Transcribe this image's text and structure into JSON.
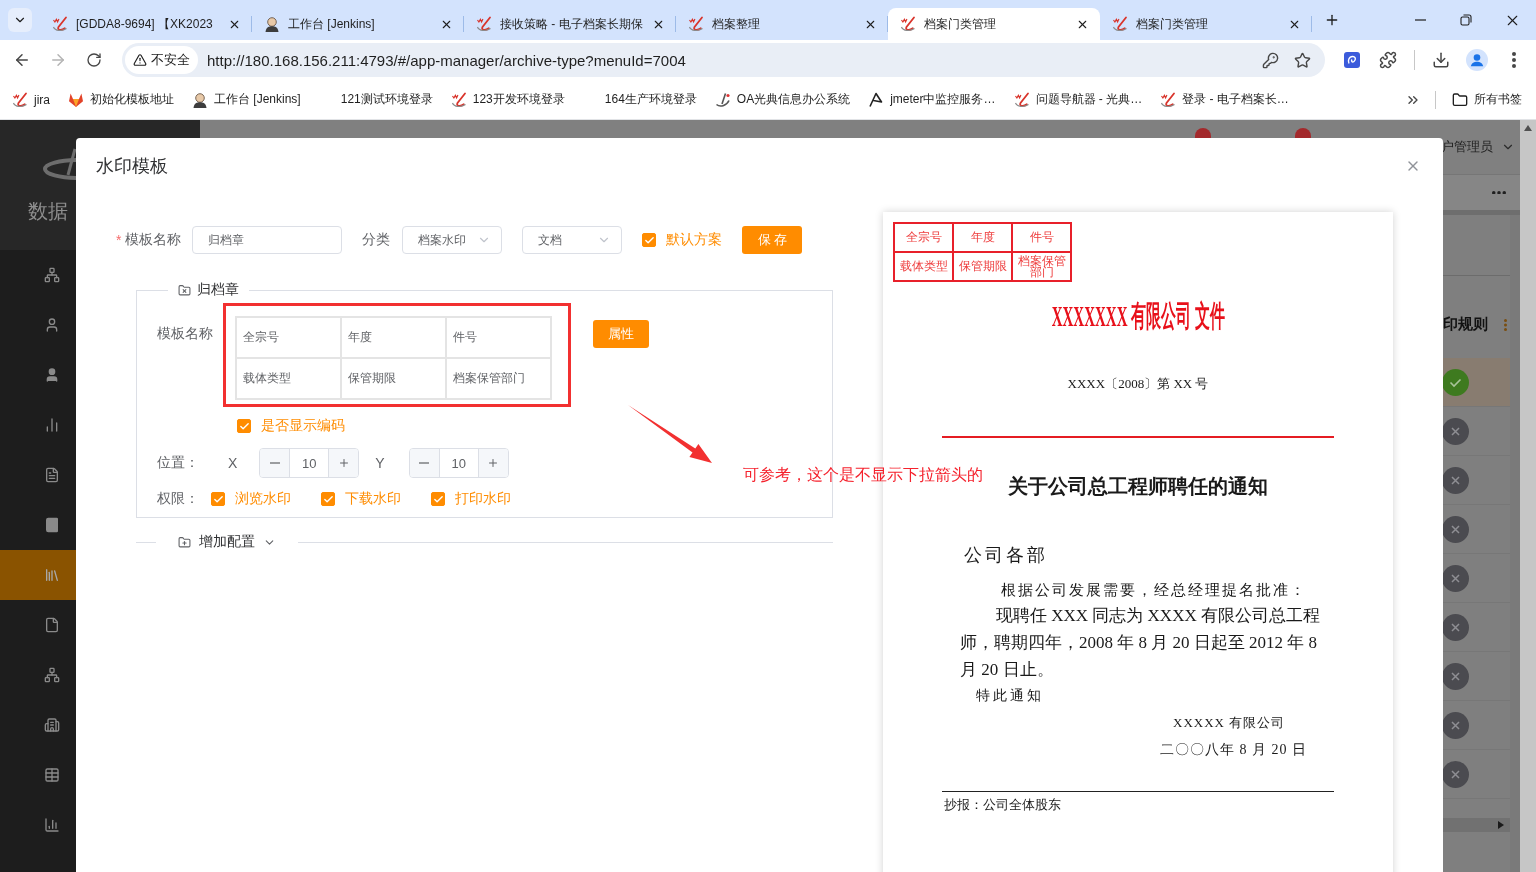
{
  "browser": {
    "tabs": [
      {
        "kind": "swirl",
        "title": "[GDDA8-9694] 【XK2023",
        "selected": false
      },
      {
        "kind": "avatar",
        "title": "工作台 [Jenkins]",
        "selected": false
      },
      {
        "kind": "swirl",
        "title": "接收策略 - 电子档案长期保",
        "selected": false
      },
      {
        "kind": "swirl",
        "title": "档案整理",
        "selected": false
      },
      {
        "kind": "swirl",
        "title": "档案门类管理",
        "selected": true
      },
      {
        "kind": "swirl",
        "title": "档案门类管理",
        "selected": false
      }
    ],
    "address_bar": {
      "security": "不安全",
      "url": "http://180.168.156.211:4793/#/app-manager/archive-type?menuId=7004"
    },
    "bookmarks": [
      {
        "kind": "swirl",
        "label": "jira"
      },
      {
        "kind": "fox",
        "label": "初始化模板地址"
      },
      {
        "kind": "avatar",
        "label": "工作台 [Jenkins]"
      },
      {
        "kind": "blank",
        "label": "121测试环境登录"
      },
      {
        "kind": "swirl",
        "label": "123开发环境登录"
      },
      {
        "kind": "blank",
        "label": "164生产环境登录"
      },
      {
        "kind": "ladle",
        "label": "OA光典信息办公系统"
      },
      {
        "kind": "feather",
        "label": "jmeter中监控服务…"
      },
      {
        "kind": "swirl",
        "label": "问题导航器 - 光典…"
      },
      {
        "kind": "swirl",
        "label": "登录 - 电子档案长…"
      }
    ],
    "all_bookmarks": "所有书签"
  },
  "app": {
    "sidebar": {
      "brand": "数据",
      "items": [
        {
          "selected": false
        },
        {
          "selected": false
        },
        {
          "selected": false
        },
        {
          "selected": false
        },
        {
          "selected": false
        },
        {
          "selected": false
        },
        {
          "selected": true
        },
        {
          "selected": false
        },
        {
          "selected": false
        },
        {
          "selected": false
        },
        {
          "selected": false
        },
        {
          "selected": false
        }
      ]
    },
    "header": {
      "user": "户管理员"
    },
    "rules": {
      "title": "印规则",
      "rows": [
        {
          "enabled": true,
          "selected": true
        },
        {
          "enabled": false,
          "selected": false
        },
        {
          "enabled": false,
          "selected": false
        },
        {
          "enabled": false,
          "selected": false
        },
        {
          "enabled": false,
          "selected": false
        },
        {
          "enabled": false,
          "selected": false
        },
        {
          "enabled": false,
          "selected": false
        },
        {
          "enabled": false,
          "selected": false
        },
        {
          "enabled": false,
          "selected": false
        }
      ]
    }
  },
  "dialog": {
    "title": "水印模板",
    "form": {
      "required_mark": "*",
      "name_label": "模板名称",
      "name_value": "归档章",
      "category_label": "分类",
      "category_value": "档案水印",
      "type_value": "文档",
      "default_plan": {
        "label": "默认方案",
        "checked": true
      },
      "save_button": "保 存"
    },
    "section": {
      "title": "归档章",
      "template_label": "模板名称",
      "grid": [
        [
          "全宗号",
          "年度",
          "件号"
        ],
        [
          "载体类型",
          "保管期限",
          "档案保管部门"
        ]
      ],
      "property_button": "属性",
      "show_code": {
        "label": "是否显示编码",
        "checked": true
      },
      "position": {
        "label": "位置：",
        "x_label": "X",
        "x_value": "10",
        "y_label": "Y",
        "y_value": "10"
      },
      "permissions": {
        "label": "权限：",
        "options": [
          {
            "label": "浏览水印",
            "checked": true
          },
          {
            "label": "下载水印",
            "checked": true
          },
          {
            "label": "打印水印",
            "checked": true
          }
        ]
      }
    },
    "add_config": {
      "label": "增加配置",
      "expanded": false
    },
    "annotation": "可参考，这个是不显示下拉箭头的",
    "preview": {
      "stamp": [
        [
          "全宗号",
          "年度",
          "件号"
        ],
        [
          "载体类型",
          "保管期限",
          "档案保管部门"
        ]
      ],
      "header": "XXXXXXX 有限公司 文件",
      "doc_number": "XXXX〔2008〕第 XX 号",
      "title": "关于公司总工程师聘任的通知",
      "salutation": "公司各部",
      "intro": "根据公司发展需要，经总经理提名批准：",
      "body": "现聘任 XXX 同志为 XXXX 有限公司总工程师，聘期四年，2008 年 8 月 20 日起至 2012 年 8 月 20 日止。",
      "closing": "特此通知",
      "signature": "XXXXX 有限公司",
      "date": "二〇〇八年 8 月 20 日",
      "cc": "抄报：公司全体股东"
    }
  }
}
